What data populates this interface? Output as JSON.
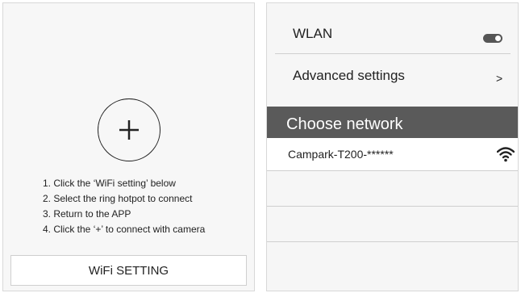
{
  "left": {
    "plus_symbol": "+",
    "steps": [
      "1. Click the ‘WiFi setting’ below",
      "2. Select the ring hotpot to connect",
      "3. Return to the APP",
      "4. Click the ‘+’ to connect with camera"
    ],
    "wifi_button_label": "WiFi SETTING"
  },
  "right": {
    "wlan_label": "WLAN",
    "wlan_enabled": true,
    "advanced_label": "Advanced settings",
    "advanced_chevron": ">",
    "choose_network_label": "Choose network",
    "networks": [
      {
        "name": "Campark-T200-******",
        "icon": "wifi-icon"
      }
    ]
  },
  "colors": {
    "header_bg": "#5a5a5a",
    "panel_bg": "#f7f7f7",
    "border": "#cfcfcf"
  }
}
